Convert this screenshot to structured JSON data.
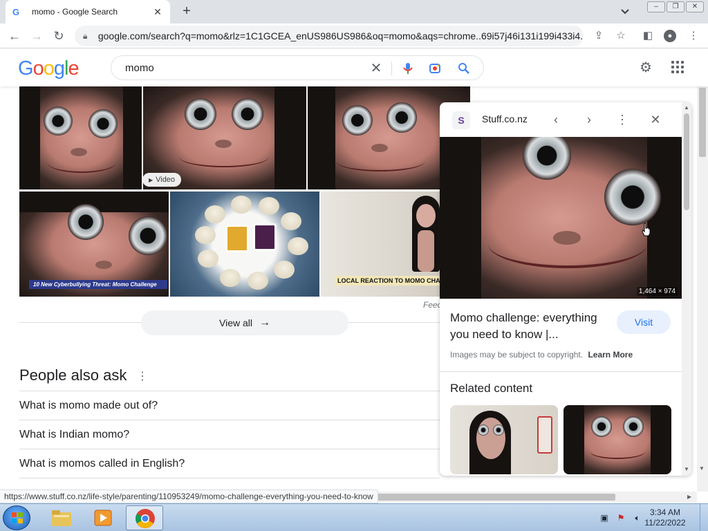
{
  "browser": {
    "tab": {
      "favicon": "G",
      "title": "momo - Google Search",
      "close": "✕"
    },
    "new_tab": "+",
    "url": "google.com/search?q=momo&rlz=1C1GCEA_enUS986US986&oq=momo&aqs=chrome..69i57j46i131i199i433i4...",
    "status_url": "https://www.stuff.co.nz/life-style/parenting/110953249/momo-challenge-everything-you-need-to-know"
  },
  "google": {
    "logo": [
      "G",
      "o",
      "o",
      "g",
      "l",
      "e"
    ],
    "logo_colors": [
      "#4285f4",
      "#ea4335",
      "#fbbc05",
      "#4285f4",
      "#34a853",
      "#ea4335"
    ],
    "search_value": "momo"
  },
  "results": {
    "video_badge": "Video",
    "caption_1": "New Cyberbullying Threat: Momo Challenge",
    "caption_1_channel": "10",
    "caption_2": "LOCAL REACTION TO MOMO CHA",
    "feedback": "Feed",
    "view_all": "View all"
  },
  "people_also_ask": {
    "title": "People also ask",
    "questions": [
      "What is momo made out of?",
      "What is Indian momo?",
      "What is momos called in English?"
    ]
  },
  "panel": {
    "site_favicon": "S",
    "site_name": "Stuff.co.nz",
    "dimensions": "1,464 × 974",
    "title": "Momo challenge: everything you need to know |...",
    "visit": "Visit",
    "copyright": "Images may be subject to copyright.",
    "learn_more": "Learn More",
    "related_title": "Related content"
  },
  "taskbar": {
    "time": "3:34 AM",
    "date": "11/22/2022"
  },
  "colors": {
    "accent": "#1a73e8",
    "tab_bar": "#dee1e6",
    "taskbar": "#a9c3e1"
  }
}
